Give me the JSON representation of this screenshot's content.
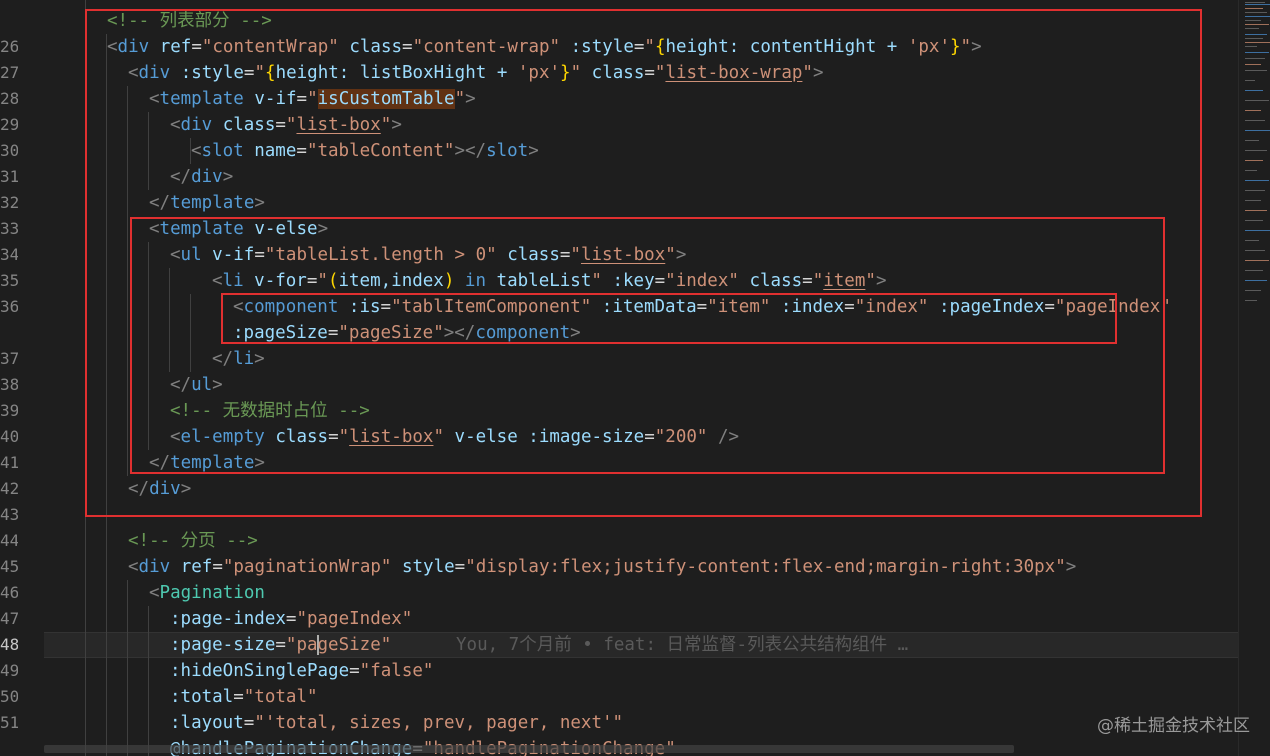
{
  "gutter_numbers": [
    "",
    "26",
    "27",
    "28",
    "29",
    "30",
    "31",
    "32",
    "33",
    "34",
    "35",
    "36",
    "",
    "37",
    "38",
    "39",
    "40",
    "41",
    "42",
    "43",
    "44",
    "45",
    "46",
    "47",
    "48",
    "49",
    "50",
    "51",
    ""
  ],
  "active_line": "48",
  "code": {
    "l0": {
      "c1": "<!-- 列表部分 -->"
    },
    "l1": {
      "a": "<",
      "b": "div",
      "c": " ref",
      "d": "=",
      "e": "\"contentWrap\"",
      "f": " class",
      "g": "=",
      "h": "\"content-wrap\"",
      "i": " :style",
      "j": "=",
      "k": "\"",
      "l": "{",
      "m": "height: contentHight + ",
      "n": "'px'",
      "o": "}",
      "p": "\"",
      ">": ">"
    },
    "l2": {
      "a": "<",
      "b": "div",
      "c": " :style",
      "d": "=",
      "e": "\"",
      "f": "{",
      "g": "height: listBoxHight + ",
      "h": "'px'",
      "i": "}",
      "j": "\"",
      "k": " class",
      "l": "=",
      "m": "\"",
      "n": "list-box-wrap",
      "o": "\"",
      "p": ">"
    },
    "l3": {
      "a": "<",
      "b": "template",
      "c": " v-if",
      "d": "=",
      "e": "\"",
      "f": "isCustomTable",
      "g": "\"",
      "h": ">"
    },
    "l4": {
      "a": "<",
      "b": "div",
      "c": " class",
      "d": "=",
      "e": "\"",
      "f": "list-box",
      "g": "\"",
      "h": ">"
    },
    "l5": {
      "a": "<",
      "b": "slot",
      "c": " name",
      "d": "=",
      "e": "\"tableContent\"",
      "f": "></",
      "g": "slot",
      "h": ">"
    },
    "l6": {
      "a": "</",
      "b": "div",
      "c": ">"
    },
    "l7": {
      "a": "</",
      "b": "template",
      "c": ">"
    },
    "l8": {
      "a": "<",
      "b": "template",
      "c": " v-else",
      "d": ">"
    },
    "l9": {
      "a": "<",
      "b": "ul",
      "c": " v-if",
      "d": "=",
      "e": "\"tableList.length > 0\"",
      "f": " class",
      "g": "=",
      "h": "\"",
      "i": "list-box",
      "j": "\"",
      "k": ">"
    },
    "l10": {
      "a": "<",
      "b": "li",
      "c": " v-for",
      "d": "=",
      "e": "\"",
      "f": "(",
      "g": "item,index",
      "h": ")",
      "i": " in ",
      "j": "tableList",
      "k": "\"",
      "l": " :key",
      "m": "=",
      "n": "\"index\"",
      "o": " class",
      "p": "=",
      "q": "\"",
      "r": "item",
      "s": "\"",
      "t": ">"
    },
    "l11": {
      "a": "<",
      "b": "component",
      "c": " :is",
      "d": "=",
      "e": "\"tablItemComponent\"",
      "f": " :itemData",
      "g": "=",
      "h": "\"item\"",
      "i": " :index",
      "j": "=",
      "k": "\"index\"",
      "l": " :pageIndex",
      "m": "=",
      "n": "\"pageIndex\""
    },
    "l12": {
      "a": ":pageSize",
      "b": "=",
      "c": "\"pageSize\"",
      "d": "></",
      "e": "component",
      "f": ">"
    },
    "l13": {
      "a": "</",
      "b": "li",
      "c": ">"
    },
    "l14": {
      "a": "</",
      "b": "ul",
      "c": ">"
    },
    "l15": {
      "c1": "<!-- 无数据时占位 -->"
    },
    "l16": {
      "a": "<",
      "b": "el-empty",
      "c": " class",
      "d": "=",
      "e": "\"",
      "f": "list-box",
      "g": "\"",
      "h": " v-else",
      "i": " :image-size",
      "j": "=",
      "k": "\"200\"",
      "l": " />"
    },
    "l17": {
      "a": "</",
      "b": "template",
      "c": ">"
    },
    "l18": {
      "a": "</",
      "b": "div",
      "c": ">"
    },
    "l20": {
      "c1": "<!-- 分页 -->"
    },
    "l21": {
      "a": "<",
      "b": "div",
      "c": " ref",
      "d": "=",
      "e": "\"paginationWrap\"",
      "f": " style",
      "g": "=",
      "h": "\"display:flex;justify-content:flex-end;margin-right:30px\"",
      "i": ">"
    },
    "l22": {
      "a": "<",
      "b": "Pagination"
    },
    "l23": {
      "a": ":page-index",
      "b": "=",
      "c": "\"pageIndex\""
    },
    "l24": {
      "a": ":page-size",
      "b": "=",
      "c1": "\"pa",
      "c2": "geSize\"",
      "blame": "You, 7个月前 • feat: 日常监督-列表公共结构组件 …"
    },
    "l25": {
      "a": ":hideOnSinglePage",
      "b": "=",
      "c": "\"false\""
    },
    "l26": {
      "a": ":total",
      "b": "=",
      "c": "\"total\""
    },
    "l27": {
      "a": ":layout",
      "b": "=",
      "c": "\"'total, sizes, prev, pager, next'\""
    },
    "l28": {
      "a": "@handlePaginationChange",
      "b": "=",
      "c": "\"handlePaginationChange\""
    }
  },
  "watermark": "@稀土掘金技术社区",
  "colors": {
    "background": "#1e1e1e",
    "tag": "#569cd6",
    "attribute": "#9cdcfe",
    "string": "#ce9178",
    "comment": "#6a9955",
    "annotation_box": "#e03030"
  }
}
